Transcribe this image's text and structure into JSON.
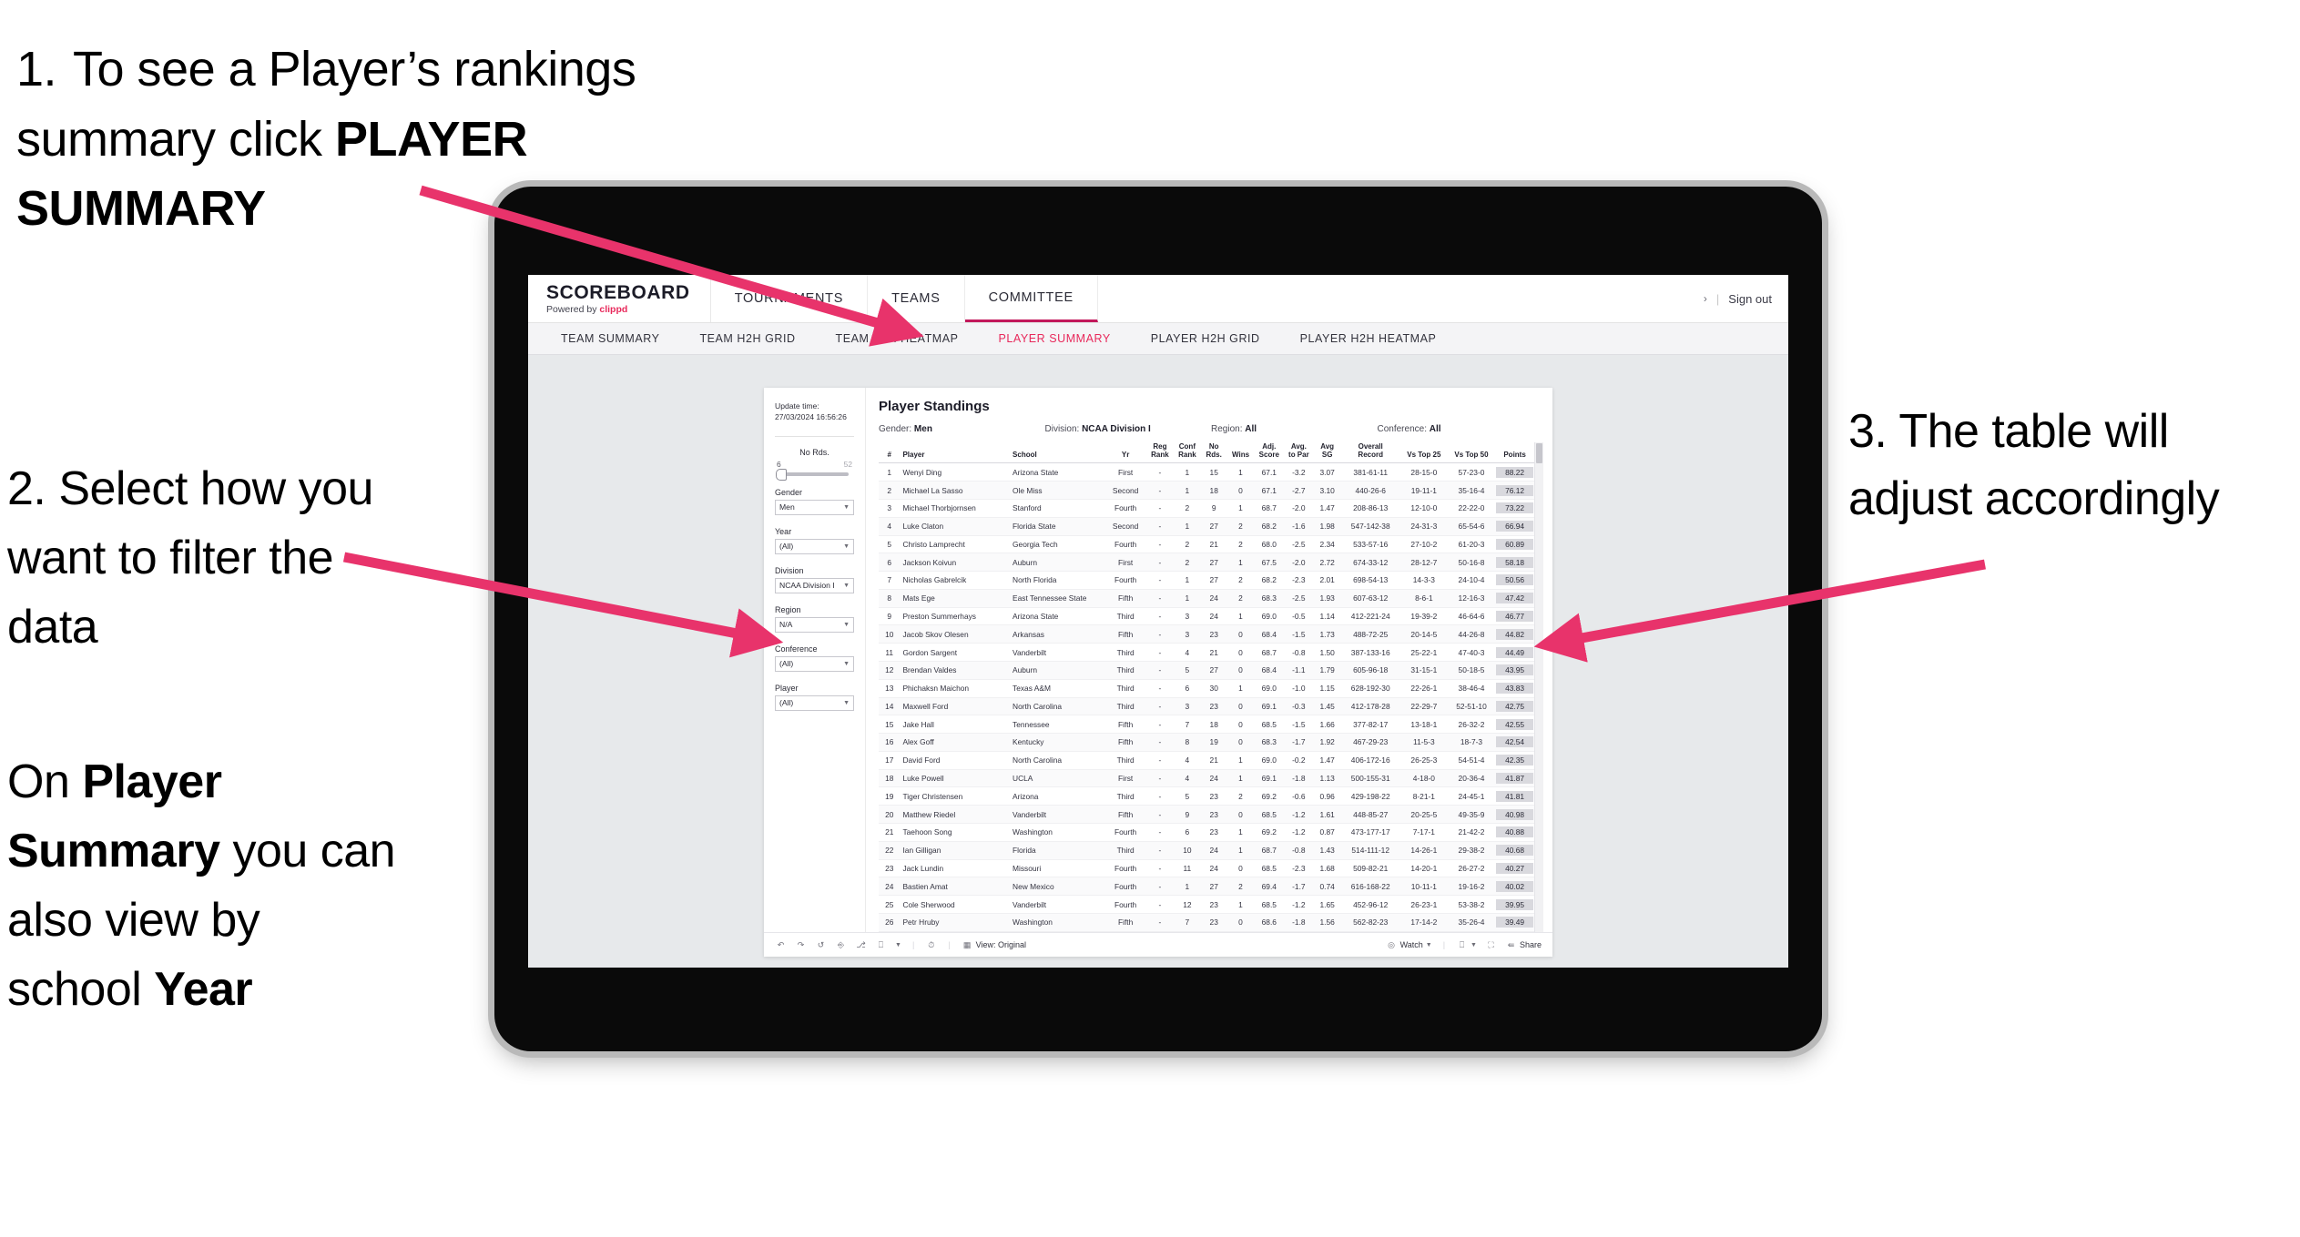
{
  "callouts": {
    "one": {
      "number": "1.",
      "text_before": "To see a Player’s rankings summary click ",
      "bold": "PLAYER SUMMARY"
    },
    "two": {
      "text": "2. Select how you want to filter the data"
    },
    "two_b": {
      "before": "On ",
      "bold1": "Player Summary",
      "middle": " you can also view by school ",
      "bold2": "Year"
    },
    "three": {
      "text": "3. The table will adjust accordingly"
    }
  },
  "accent_pink": "#e8295b",
  "arrow_color": "#e8336b",
  "app": {
    "brand": {
      "title": "SCOREBOARD",
      "powered_prefix": "Powered by ",
      "powered_brand": "clippd"
    },
    "top_nav": [
      {
        "label": "TOURNAMENTS",
        "active": false
      },
      {
        "label": "TEAMS",
        "active": false
      },
      {
        "label": "COMMITTEE",
        "active": true
      }
    ],
    "header_right": {
      "chevron": "›",
      "separator": "|",
      "sign_out": "Sign out"
    },
    "sub_nav": [
      {
        "label": "TEAM SUMMARY",
        "active": false
      },
      {
        "label": "TEAM H2H GRID",
        "active": false
      },
      {
        "label": "TEAM H2H HEATMAP",
        "active": false
      },
      {
        "label": "PLAYER SUMMARY",
        "active": true
      },
      {
        "label": "PLAYER H2H GRID",
        "active": false
      },
      {
        "label": "PLAYER H2H HEATMAP",
        "active": false
      }
    ]
  },
  "filters": {
    "update_time_label": "Update time:",
    "update_time_value": "27/03/2024 16:56:26",
    "slider": {
      "label": "No Rds.",
      "min": "6",
      "max": "52"
    },
    "groups": [
      {
        "label": "Gender",
        "value": "Men"
      },
      {
        "label": "Year",
        "value": "(All)"
      },
      {
        "label": "Division",
        "value": "NCAA Division I"
      },
      {
        "label": "Region",
        "value": "N/A"
      },
      {
        "label": "Conference",
        "value": "(All)"
      },
      {
        "label": "Player",
        "value": "(All)"
      }
    ]
  },
  "viz": {
    "title": "Player Standings",
    "filter_summary": [
      {
        "label": "Gender:",
        "value": "Men"
      },
      {
        "label": "Division:",
        "value": "NCAA Division I"
      },
      {
        "label": "Region:",
        "value": "All"
      },
      {
        "label": "Conference:",
        "value": "All"
      }
    ],
    "columns": [
      {
        "key": "rank",
        "l1": "#",
        "l2": ""
      },
      {
        "key": "player",
        "l1": "Player",
        "l2": ""
      },
      {
        "key": "school",
        "l1": "School",
        "l2": ""
      },
      {
        "key": "yr",
        "l1": "Yr",
        "l2": ""
      },
      {
        "key": "reg_rank",
        "l1": "Reg",
        "l2": "Rank"
      },
      {
        "key": "conf_rank",
        "l1": "Conf",
        "l2": "Rank"
      },
      {
        "key": "no_rds",
        "l1": "No",
        "l2": "Rds."
      },
      {
        "key": "wins",
        "l1": "Wins",
        "l2": ""
      },
      {
        "key": "adj_score",
        "l1": "Adj.",
        "l2": "Score"
      },
      {
        "key": "avg_to_par",
        "l1": "Avg.",
        "l2": "to Par"
      },
      {
        "key": "avg_sg",
        "l1": "Avg",
        "l2": "SG"
      },
      {
        "key": "overall_record",
        "l1": "Overall",
        "l2": "Record"
      },
      {
        "key": "vs_top_25",
        "l1": "Vs Top 25",
        "l2": ""
      },
      {
        "key": "vs_top_50",
        "l1": "Vs Top 50",
        "l2": ""
      },
      {
        "key": "points",
        "l1": "Points",
        "l2": ""
      }
    ],
    "rows": [
      {
        "rank": "1",
        "player": "Wenyi Ding",
        "school": "Arizona State",
        "yr": "First",
        "reg_rank": "-",
        "conf_rank": "1",
        "no_rds": "15",
        "wins": "1",
        "adj_score": "67.1",
        "avg_to_par": "-3.2",
        "avg_sg": "3.07",
        "overall_record": "381-61-11",
        "vs_top_25": "28-15-0",
        "vs_top_50": "57-23-0",
        "points": "88.22"
      },
      {
        "rank": "2",
        "player": "Michael La Sasso",
        "school": "Ole Miss",
        "yr": "Second",
        "reg_rank": "-",
        "conf_rank": "1",
        "no_rds": "18",
        "wins": "0",
        "adj_score": "67.1",
        "avg_to_par": "-2.7",
        "avg_sg": "3.10",
        "overall_record": "440-26-6",
        "vs_top_25": "19-11-1",
        "vs_top_50": "35-16-4",
        "points": "76.12"
      },
      {
        "rank": "3",
        "player": "Michael Thorbjornsen",
        "school": "Stanford",
        "yr": "Fourth",
        "reg_rank": "-",
        "conf_rank": "2",
        "no_rds": "9",
        "wins": "1",
        "adj_score": "68.7",
        "avg_to_par": "-2.0",
        "avg_sg": "1.47",
        "overall_record": "208-86-13",
        "vs_top_25": "12-10-0",
        "vs_top_50": "22-22-0",
        "points": "73.22"
      },
      {
        "rank": "4",
        "player": "Luke Claton",
        "school": "Florida State",
        "yr": "Second",
        "reg_rank": "-",
        "conf_rank": "1",
        "no_rds": "27",
        "wins": "2",
        "adj_score": "68.2",
        "avg_to_par": "-1.6",
        "avg_sg": "1.98",
        "overall_record": "547-142-38",
        "vs_top_25": "24-31-3",
        "vs_top_50": "65-54-6",
        "points": "66.94"
      },
      {
        "rank": "5",
        "player": "Christo Lamprecht",
        "school": "Georgia Tech",
        "yr": "Fourth",
        "reg_rank": "-",
        "conf_rank": "2",
        "no_rds": "21",
        "wins": "2",
        "adj_score": "68.0",
        "avg_to_par": "-2.5",
        "avg_sg": "2.34",
        "overall_record": "533-57-16",
        "vs_top_25": "27-10-2",
        "vs_top_50": "61-20-3",
        "points": "60.89"
      },
      {
        "rank": "6",
        "player": "Jackson Koivun",
        "school": "Auburn",
        "yr": "First",
        "reg_rank": "-",
        "conf_rank": "2",
        "no_rds": "27",
        "wins": "1",
        "adj_score": "67.5",
        "avg_to_par": "-2.0",
        "avg_sg": "2.72",
        "overall_record": "674-33-12",
        "vs_top_25": "28-12-7",
        "vs_top_50": "50-16-8",
        "points": "58.18"
      },
      {
        "rank": "7",
        "player": "Nicholas Gabrelcik",
        "school": "North Florida",
        "yr": "Fourth",
        "reg_rank": "-",
        "conf_rank": "1",
        "no_rds": "27",
        "wins": "2",
        "adj_score": "68.2",
        "avg_to_par": "-2.3",
        "avg_sg": "2.01",
        "overall_record": "698-54-13",
        "vs_top_25": "14-3-3",
        "vs_top_50": "24-10-4",
        "points": "50.56"
      },
      {
        "rank": "8",
        "player": "Mats Ege",
        "school": "East Tennessee State",
        "yr": "Fifth",
        "reg_rank": "-",
        "conf_rank": "1",
        "no_rds": "24",
        "wins": "2",
        "adj_score": "68.3",
        "avg_to_par": "-2.5",
        "avg_sg": "1.93",
        "overall_record": "607-63-12",
        "vs_top_25": "8-6-1",
        "vs_top_50": "12-16-3",
        "points": "47.42"
      },
      {
        "rank": "9",
        "player": "Preston Summerhays",
        "school": "Arizona State",
        "yr": "Third",
        "reg_rank": "-",
        "conf_rank": "3",
        "no_rds": "24",
        "wins": "1",
        "adj_score": "69.0",
        "avg_to_par": "-0.5",
        "avg_sg": "1.14",
        "overall_record": "412-221-24",
        "vs_top_25": "19-39-2",
        "vs_top_50": "46-64-6",
        "points": "46.77"
      },
      {
        "rank": "10",
        "player": "Jacob Skov Olesen",
        "school": "Arkansas",
        "yr": "Fifth",
        "reg_rank": "-",
        "conf_rank": "3",
        "no_rds": "23",
        "wins": "0",
        "adj_score": "68.4",
        "avg_to_par": "-1.5",
        "avg_sg": "1.73",
        "overall_record": "488-72-25",
        "vs_top_25": "20-14-5",
        "vs_top_50": "44-26-8",
        "points": "44.82"
      },
      {
        "rank": "11",
        "player": "Gordon Sargent",
        "school": "Vanderbilt",
        "yr": "Third",
        "reg_rank": "-",
        "conf_rank": "4",
        "no_rds": "21",
        "wins": "0",
        "adj_score": "68.7",
        "avg_to_par": "-0.8",
        "avg_sg": "1.50",
        "overall_record": "387-133-16",
        "vs_top_25": "25-22-1",
        "vs_top_50": "47-40-3",
        "points": "44.49"
      },
      {
        "rank": "12",
        "player": "Brendan Valdes",
        "school": "Auburn",
        "yr": "Third",
        "reg_rank": "-",
        "conf_rank": "5",
        "no_rds": "27",
        "wins": "0",
        "adj_score": "68.4",
        "avg_to_par": "-1.1",
        "avg_sg": "1.79",
        "overall_record": "605-96-18",
        "vs_top_25": "31-15-1",
        "vs_top_50": "50-18-5",
        "points": "43.95"
      },
      {
        "rank": "13",
        "player": "Phichaksn Maichon",
        "school": "Texas A&M",
        "yr": "Third",
        "reg_rank": "-",
        "conf_rank": "6",
        "no_rds": "30",
        "wins": "1",
        "adj_score": "69.0",
        "avg_to_par": "-1.0",
        "avg_sg": "1.15",
        "overall_record": "628-192-30",
        "vs_top_25": "22-26-1",
        "vs_top_50": "38-46-4",
        "points": "43.83"
      },
      {
        "rank": "14",
        "player": "Maxwell Ford",
        "school": "North Carolina",
        "yr": "Third",
        "reg_rank": "-",
        "conf_rank": "3",
        "no_rds": "23",
        "wins": "0",
        "adj_score": "69.1",
        "avg_to_par": "-0.3",
        "avg_sg": "1.45",
        "overall_record": "412-178-28",
        "vs_top_25": "22-29-7",
        "vs_top_50": "52-51-10",
        "points": "42.75"
      },
      {
        "rank": "15",
        "player": "Jake Hall",
        "school": "Tennessee",
        "yr": "Fifth",
        "reg_rank": "-",
        "conf_rank": "7",
        "no_rds": "18",
        "wins": "0",
        "adj_score": "68.5",
        "avg_to_par": "-1.5",
        "avg_sg": "1.66",
        "overall_record": "377-82-17",
        "vs_top_25": "13-18-1",
        "vs_top_50": "26-32-2",
        "points": "42.55"
      },
      {
        "rank": "16",
        "player": "Alex Goff",
        "school": "Kentucky",
        "yr": "Fifth",
        "reg_rank": "-",
        "conf_rank": "8",
        "no_rds": "19",
        "wins": "0",
        "adj_score": "68.3",
        "avg_to_par": "-1.7",
        "avg_sg": "1.92",
        "overall_record": "467-29-23",
        "vs_top_25": "11-5-3",
        "vs_top_50": "18-7-3",
        "points": "42.54"
      },
      {
        "rank": "17",
        "player": "David Ford",
        "school": "North Carolina",
        "yr": "Third",
        "reg_rank": "-",
        "conf_rank": "4",
        "no_rds": "21",
        "wins": "1",
        "adj_score": "69.0",
        "avg_to_par": "-0.2",
        "avg_sg": "1.47",
        "overall_record": "406-172-16",
        "vs_top_25": "26-25-3",
        "vs_top_50": "54-51-4",
        "points": "42.35"
      },
      {
        "rank": "18",
        "player": "Luke Powell",
        "school": "UCLA",
        "yr": "First",
        "reg_rank": "-",
        "conf_rank": "4",
        "no_rds": "24",
        "wins": "1",
        "adj_score": "69.1",
        "avg_to_par": "-1.8",
        "avg_sg": "1.13",
        "overall_record": "500-155-31",
        "vs_top_25": "4-18-0",
        "vs_top_50": "20-36-4",
        "points": "41.87"
      },
      {
        "rank": "19",
        "player": "Tiger Christensen",
        "school": "Arizona",
        "yr": "Third",
        "reg_rank": "-",
        "conf_rank": "5",
        "no_rds": "23",
        "wins": "2",
        "adj_score": "69.2",
        "avg_to_par": "-0.6",
        "avg_sg": "0.96",
        "overall_record": "429-198-22",
        "vs_top_25": "8-21-1",
        "vs_top_50": "24-45-1",
        "points": "41.81"
      },
      {
        "rank": "20",
        "player": "Matthew Riedel",
        "school": "Vanderbilt",
        "yr": "Fifth",
        "reg_rank": "-",
        "conf_rank": "9",
        "no_rds": "23",
        "wins": "0",
        "adj_score": "68.5",
        "avg_to_par": "-1.2",
        "avg_sg": "1.61",
        "overall_record": "448-85-27",
        "vs_top_25": "20-25-5",
        "vs_top_50": "49-35-9",
        "points": "40.98"
      },
      {
        "rank": "21",
        "player": "Taehoon Song",
        "school": "Washington",
        "yr": "Fourth",
        "reg_rank": "-",
        "conf_rank": "6",
        "no_rds": "23",
        "wins": "1",
        "adj_score": "69.2",
        "avg_to_par": "-1.2",
        "avg_sg": "0.87",
        "overall_record": "473-177-17",
        "vs_top_25": "7-17-1",
        "vs_top_50": "21-42-2",
        "points": "40.88"
      },
      {
        "rank": "22",
        "player": "Ian Gilligan",
        "school": "Florida",
        "yr": "Third",
        "reg_rank": "-",
        "conf_rank": "10",
        "no_rds": "24",
        "wins": "1",
        "adj_score": "68.7",
        "avg_to_par": "-0.8",
        "avg_sg": "1.43",
        "overall_record": "514-111-12",
        "vs_top_25": "14-26-1",
        "vs_top_50": "29-38-2",
        "points": "40.68"
      },
      {
        "rank": "23",
        "player": "Jack Lundin",
        "school": "Missouri",
        "yr": "Fourth",
        "reg_rank": "-",
        "conf_rank": "11",
        "no_rds": "24",
        "wins": "0",
        "adj_score": "68.5",
        "avg_to_par": "-2.3",
        "avg_sg": "1.68",
        "overall_record": "509-82-21",
        "vs_top_25": "14-20-1",
        "vs_top_50": "26-27-2",
        "points": "40.27"
      },
      {
        "rank": "24",
        "player": "Bastien Amat",
        "school": "New Mexico",
        "yr": "Fourth",
        "reg_rank": "-",
        "conf_rank": "1",
        "no_rds": "27",
        "wins": "2",
        "adj_score": "69.4",
        "avg_to_par": "-1.7",
        "avg_sg": "0.74",
        "overall_record": "616-168-22",
        "vs_top_25": "10-11-1",
        "vs_top_50": "19-16-2",
        "points": "40.02"
      },
      {
        "rank": "25",
        "player": "Cole Sherwood",
        "school": "Vanderbilt",
        "yr": "Fourth",
        "reg_rank": "-",
        "conf_rank": "12",
        "no_rds": "23",
        "wins": "1",
        "adj_score": "68.5",
        "avg_to_par": "-1.2",
        "avg_sg": "1.65",
        "overall_record": "452-96-12",
        "vs_top_25": "26-23-1",
        "vs_top_50": "53-38-2",
        "points": "39.95"
      },
      {
        "rank": "26",
        "player": "Petr Hruby",
        "school": "Washington",
        "yr": "Fifth",
        "reg_rank": "-",
        "conf_rank": "7",
        "no_rds": "23",
        "wins": "0",
        "adj_score": "68.6",
        "avg_to_par": "-1.8",
        "avg_sg": "1.56",
        "overall_record": "562-82-23",
        "vs_top_25": "17-14-2",
        "vs_top_50": "35-26-4",
        "points": "39.49"
      }
    ]
  },
  "toolbar": {
    "view_label": "View: Original",
    "watch_label": "Watch",
    "share_label": "Share"
  }
}
